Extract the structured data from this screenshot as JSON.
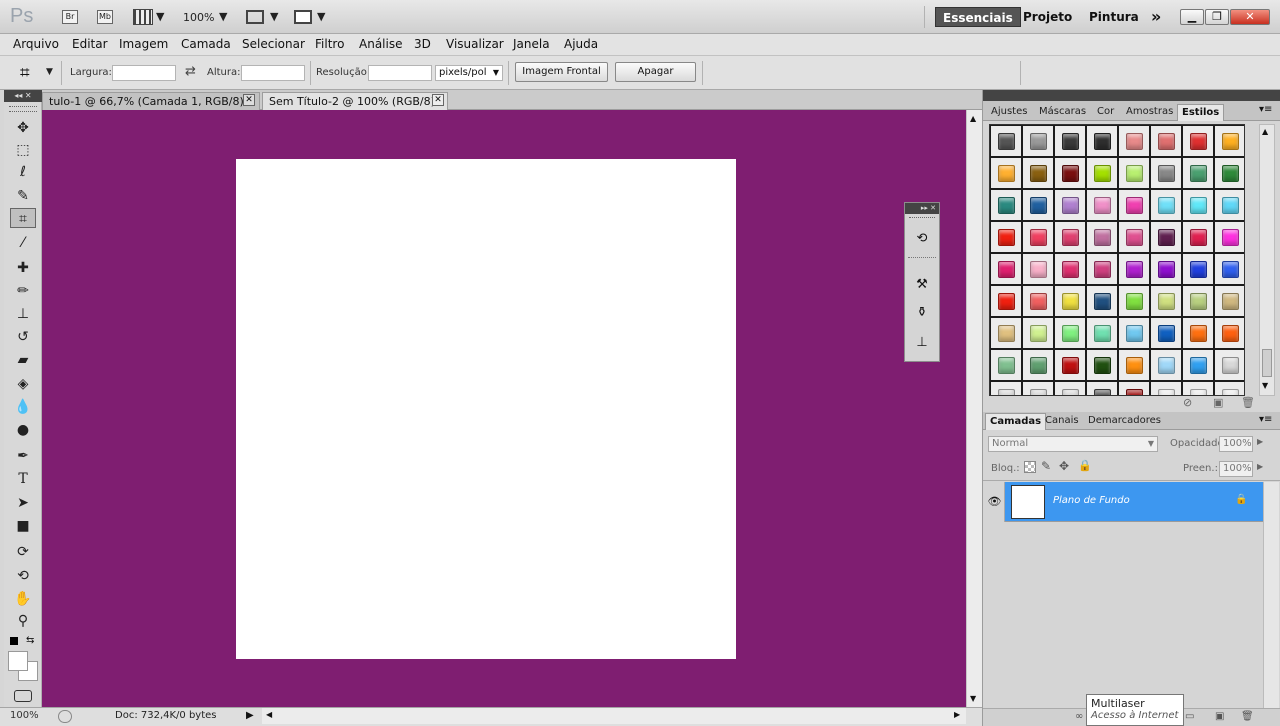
{
  "app": {
    "logo": "Ps",
    "zoom": "100%",
    "workspaces": [
      "Essenciais",
      "Projeto",
      "Pintura"
    ],
    "more": "»"
  },
  "menu": [
    "Arquivo",
    "Editar",
    "Imagem",
    "Camada",
    "Selecionar",
    "Filtro",
    "Análise",
    "3D",
    "Visualizar",
    "Janela",
    "Ajuda"
  ],
  "options": {
    "largura": "Largura:",
    "altura": "Altura:",
    "resolucao": "Resolução:",
    "unit": "pixels/pol",
    "front_button": "Imagem Frontal",
    "clear_button": "Apagar"
  },
  "documents": [
    {
      "title": "tulo-1 @ 66,7% (Camada 1, RGB/8) *"
    },
    {
      "title": "Sem Título-2 @ 100% (RGB/8)"
    }
  ],
  "status": {
    "zoom": "100%",
    "doc": "Doc: 732,4K/0 bytes"
  },
  "panels": {
    "styles_tabs": [
      "Ajustes",
      "Máscaras",
      "Cor",
      "Amostras",
      "Estilos"
    ],
    "layers_tabs": [
      "Camadas",
      "Canais",
      "Demarcadores"
    ],
    "blend_mode": "Normal",
    "opacity_label": "Opacidade:",
    "opacity_value": "100%",
    "lock_label": "Bloq.:",
    "fill_label": "Preen.:",
    "fill_value": "100%",
    "layer_name": "Plano de Fundo"
  },
  "swatch_colors": [
    "#555555",
    "#9a9a9a",
    "#3a3a3a",
    "#2e2e2e",
    "#e88a8a",
    "#e07070",
    "#e03030",
    "#ffb020",
    "#ffb030",
    "#8a6010",
    "#7a1010",
    "#a4e000",
    "#b8f070",
    "#888888",
    "#4aa070",
    "#2e8a3a",
    "#2a8a80",
    "#2060a0",
    "#b080d0",
    "#f090c8",
    "#f040b0",
    "#70e0f8",
    "#60e8f8",
    "#60d8f8",
    "#f02010",
    "#f04060",
    "#e04070",
    "#c070a0",
    "#e05090",
    "#602050",
    "#e02050",
    "#ff30e0",
    "#e02070",
    "#f8b0c8",
    "#e03070",
    "#d04080",
    "#b020d0",
    "#9010d0",
    "#2040e0",
    "#3060f0",
    "#f02010",
    "#f06060",
    "#f0e040",
    "#205080",
    "#80e040",
    "#d0e080",
    "#b8d080",
    "#d0b880",
    "#e0c080",
    "#d0f090",
    "#80f080",
    "#70e0b0",
    "#70c8f0",
    "#1060c0",
    "#ff7010",
    "#ff6010",
    "#80c090",
    "#60a070",
    "#c01010",
    "#205010",
    "#ff9010",
    "#a0d8f8",
    "#30a0f0",
    "#d8d8d8",
    "#d8d8d8",
    "#d8d8d8",
    "#d8d8d8",
    "#555555",
    "#a01010",
    "#ececec",
    "#ececec",
    "#ececec"
  ],
  "tooltip": {
    "title": "Multilaser",
    "subtitle": "Acesso à Internet"
  }
}
